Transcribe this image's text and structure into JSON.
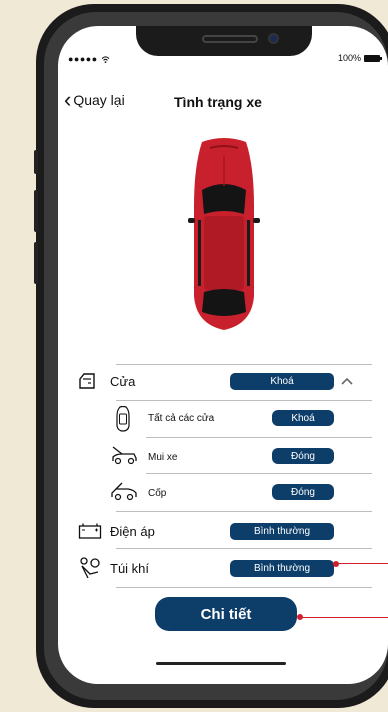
{
  "status_bar": {
    "signal": "●●●●● ",
    "battery_percent": "100%"
  },
  "header": {
    "back_label": "Quay lại",
    "title": "Tình trạng xe"
  },
  "status_rows": {
    "door": {
      "label": "Cửa",
      "value": "Khoá"
    },
    "all_doors": {
      "label": "Tất cả các cửa",
      "value": "Khoá"
    },
    "hood": {
      "label": "Mui xe",
      "value": "Đóng"
    },
    "trunk": {
      "label": "Cốp",
      "value": "Đóng"
    },
    "voltage": {
      "label": "Điện áp",
      "value": "Bình thường"
    },
    "airbag": {
      "label": "Túi khí",
      "value": "Bình thường"
    }
  },
  "actions": {
    "detail_label": "Chi tiết"
  },
  "colors": {
    "accent": "#0d3e6a",
    "callout": "#d4202e",
    "car": "#c8202c"
  },
  "icons": [
    "wifi-icon",
    "battery-icon",
    "chevron-left-icon",
    "chevron-up-icon",
    "door-icon",
    "car-top-icon",
    "hood-icon",
    "trunk-icon",
    "battery-voltage-icon",
    "airbag-icon"
  ]
}
